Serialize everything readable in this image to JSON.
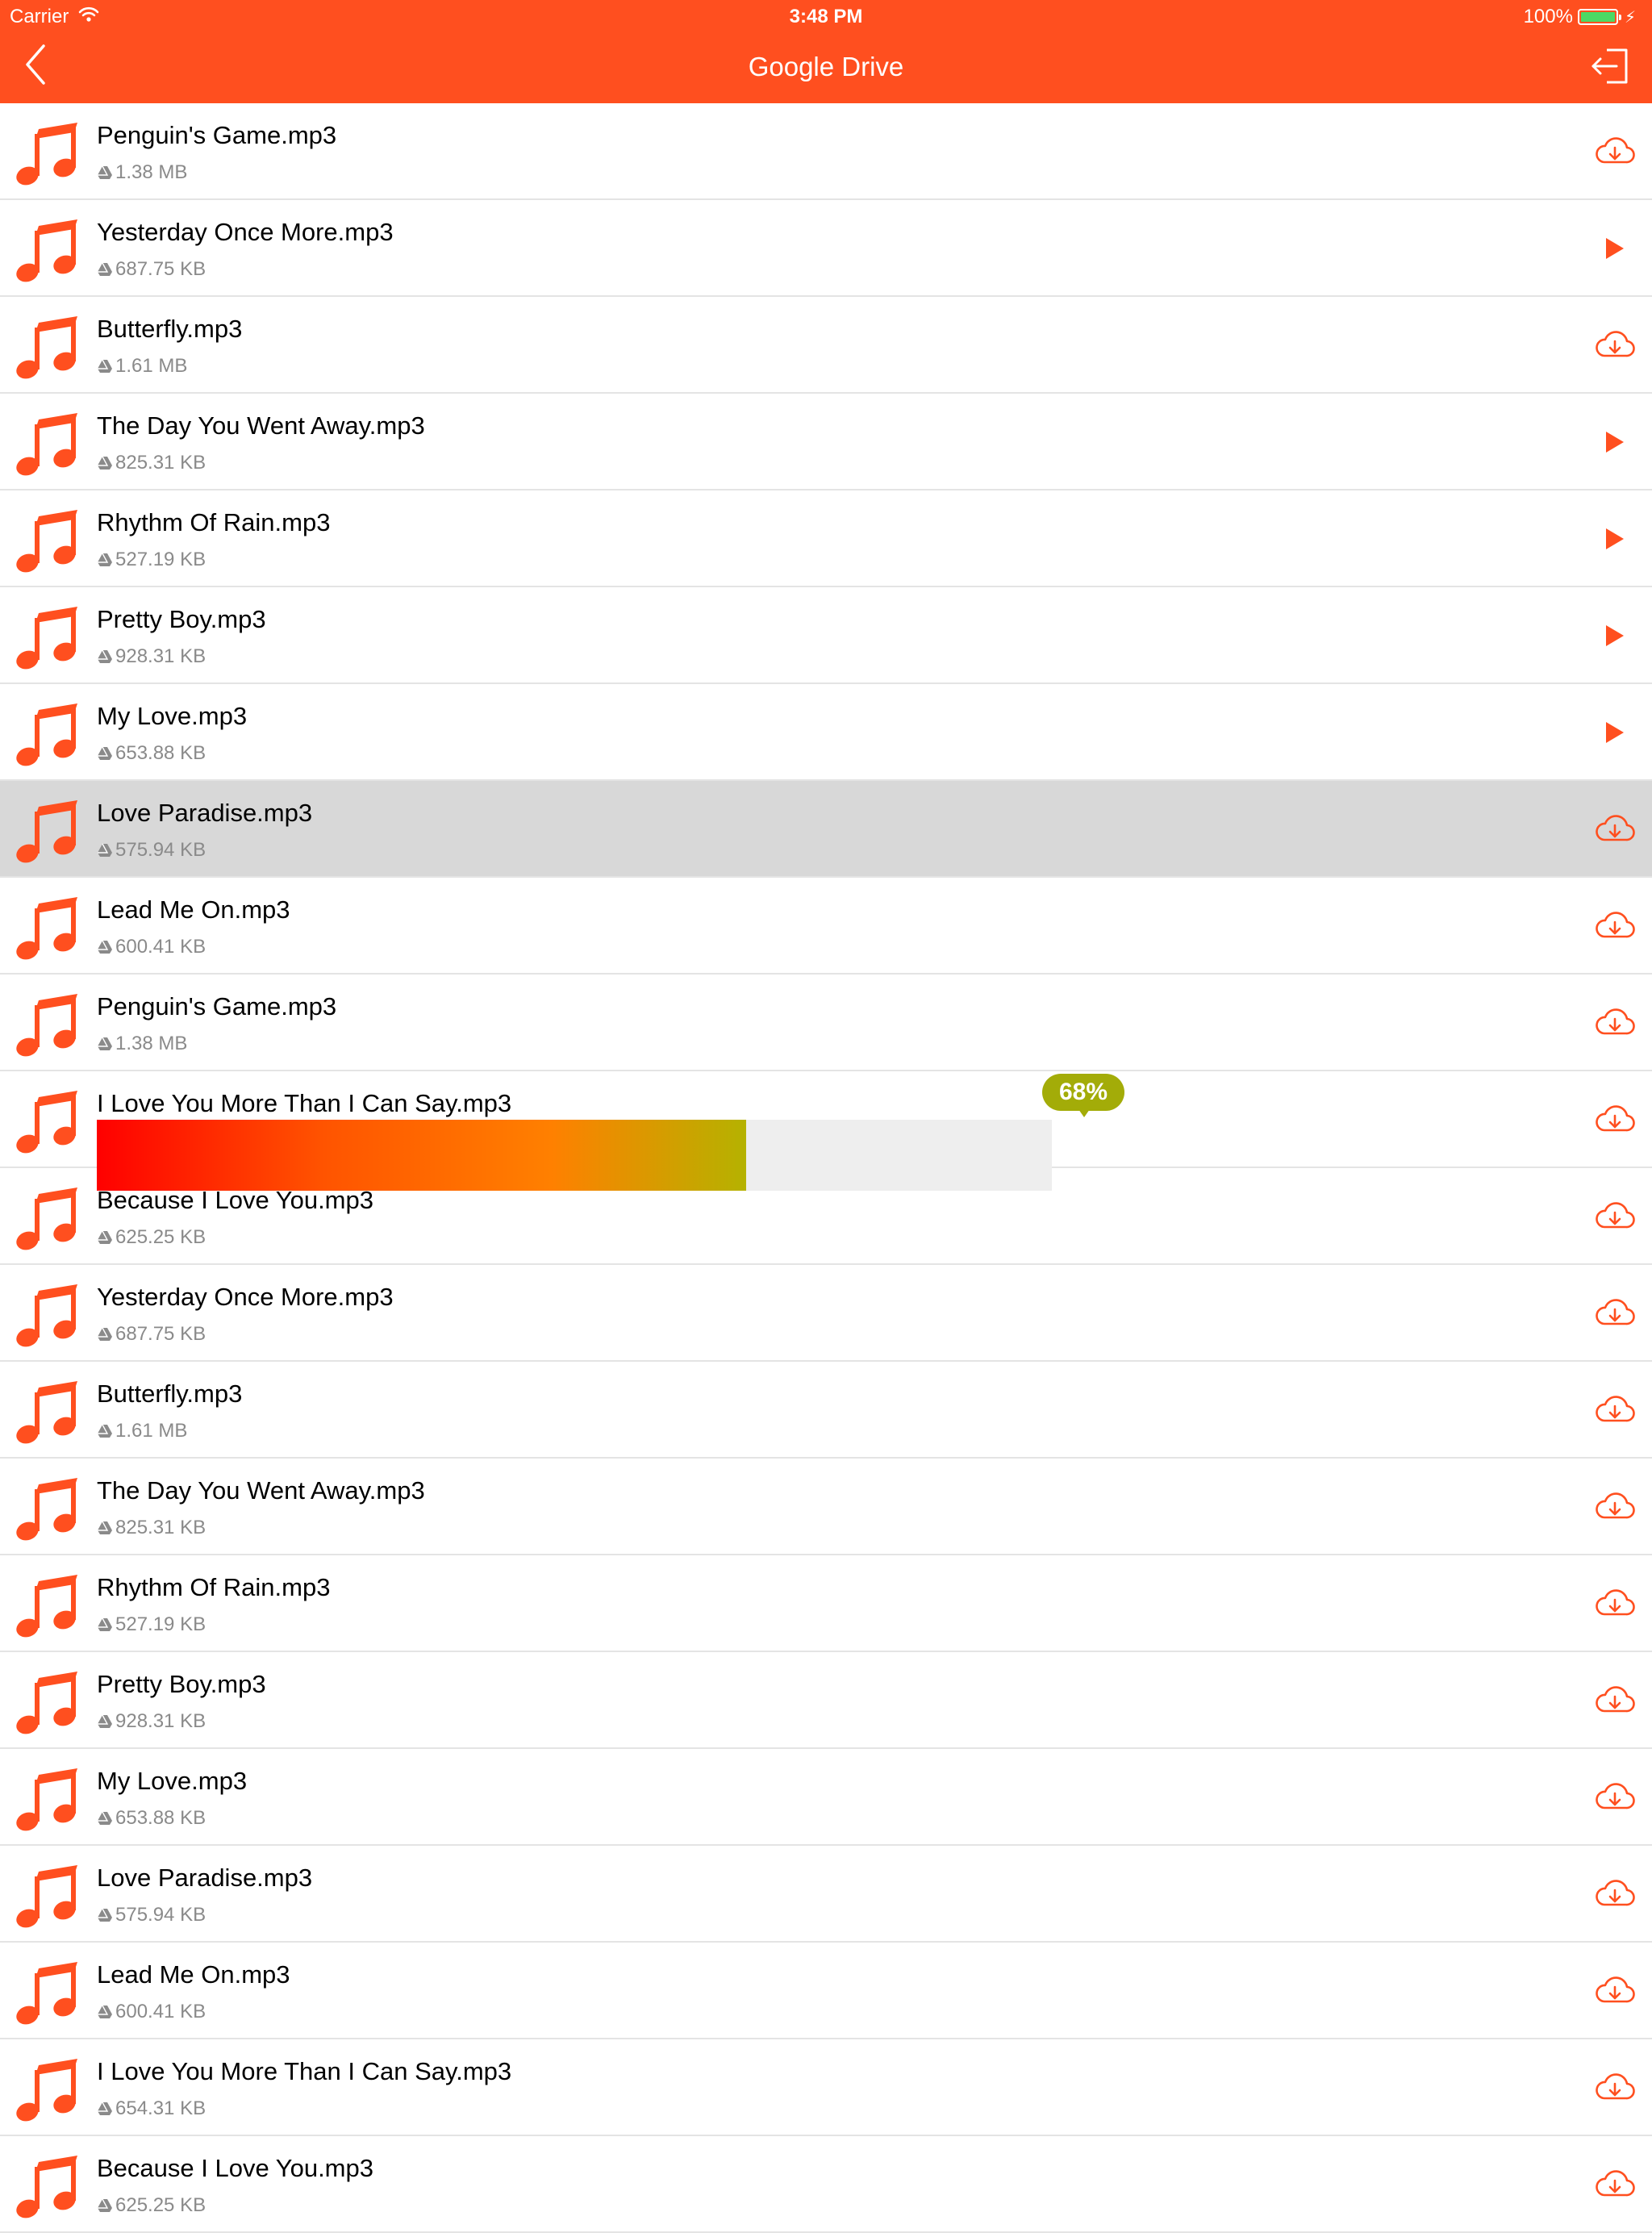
{
  "status_bar": {
    "carrier": "Carrier",
    "time": "3:48 PM",
    "battery": "100%"
  },
  "nav": {
    "title": "Google Drive",
    "back_icon": "chevron-left-icon",
    "logout_icon": "sign-out-icon"
  },
  "colors": {
    "accent": "#ff4f1f",
    "progress_badge": "#a3ac08",
    "selected_row": "#d8d8d8"
  },
  "files": [
    {
      "name": "Penguin's Game.mp3",
      "size": "1.38 MB",
      "action": "download"
    },
    {
      "name": "Yesterday Once More.mp3",
      "size": "687.75 KB",
      "action": "play"
    },
    {
      "name": "Butterfly.mp3",
      "size": "1.61 MB",
      "action": "download"
    },
    {
      "name": "The Day You Went Away.mp3",
      "size": "825.31 KB",
      "action": "play"
    },
    {
      "name": "Rhythm Of Rain.mp3",
      "size": "527.19 KB",
      "action": "play"
    },
    {
      "name": "Pretty Boy.mp3",
      "size": "928.31 KB",
      "action": "play"
    },
    {
      "name": "My Love.mp3",
      "size": "653.88 KB",
      "action": "play"
    },
    {
      "name": "Love Paradise.mp3",
      "size": "575.94 KB",
      "action": "download",
      "selected": true
    },
    {
      "name": "Lead Me On.mp3",
      "size": "600.41 KB",
      "action": "download"
    },
    {
      "name": "Penguin's Game.mp3",
      "size": "1.38 MB",
      "action": "download"
    },
    {
      "name": "I Love You More Than I Can Say.mp3",
      "size": "",
      "action": "download",
      "progress": 0.68,
      "progress_label": "68%"
    },
    {
      "name": "Because I Love You.mp3",
      "size": "625.25 KB",
      "action": "download"
    },
    {
      "name": "Yesterday Once More.mp3",
      "size": "687.75 KB",
      "action": "download"
    },
    {
      "name": "Butterfly.mp3",
      "size": "1.61 MB",
      "action": "download"
    },
    {
      "name": "The Day You Went Away.mp3",
      "size": "825.31 KB",
      "action": "download"
    },
    {
      "name": "Rhythm Of Rain.mp3",
      "size": "527.19 KB",
      "action": "download"
    },
    {
      "name": "Pretty Boy.mp3",
      "size": "928.31 KB",
      "action": "download"
    },
    {
      "name": "My Love.mp3",
      "size": "653.88 KB",
      "action": "download"
    },
    {
      "name": "Love Paradise.mp3",
      "size": "575.94 KB",
      "action": "download"
    },
    {
      "name": "Lead Me On.mp3",
      "size": "600.41 KB",
      "action": "download"
    },
    {
      "name": "I Love You More Than I Can Say.mp3",
      "size": "654.31 KB",
      "action": "download"
    },
    {
      "name": "Because I Love You.mp3",
      "size": "625.25 KB",
      "action": "download"
    }
  ]
}
